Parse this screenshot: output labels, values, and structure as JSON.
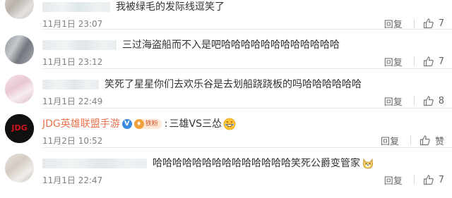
{
  "comments": [
    {
      "user": "",
      "text": "我被绿毛的发际线逗笑了",
      "time": "11月1日 23:07",
      "reply": "回复",
      "likes": "7"
    },
    {
      "user": "",
      "text": "三过海盗船而不入是吧哈哈哈哈哈哈哈哈哈哈哈哈",
      "time": "11月1日 23:12",
      "reply": "回复",
      "likes": "7"
    },
    {
      "user": "",
      "text": "笑死了星星你们去欢乐谷是去划船跷跷板的吗哈哈哈哈哈哈",
      "time": "11月1日 22:49",
      "reply": "回复",
      "likes": "8"
    },
    {
      "user": "JDG英雄联盟手游",
      "vip": "V",
      "fan_badge": "铁粉",
      "text": "三雄VS三怂",
      "emoji": "grin-emoji",
      "time": "11月2日 10:52",
      "reply": "回复",
      "likes": "赞",
      "avatar_logo": "JDG"
    },
    {
      "user": "",
      "text": "哈哈哈哈哈哈哈哈哈哈哈哈哈哈笑死公爵变管家",
      "emoji": "dog-emoji",
      "time": "11月1日 22:47",
      "reply": "回复",
      "likes": "7"
    }
  ],
  "colors": {
    "username": "#eb7350",
    "meta": "#808080",
    "divider": "#e6e6e6"
  }
}
